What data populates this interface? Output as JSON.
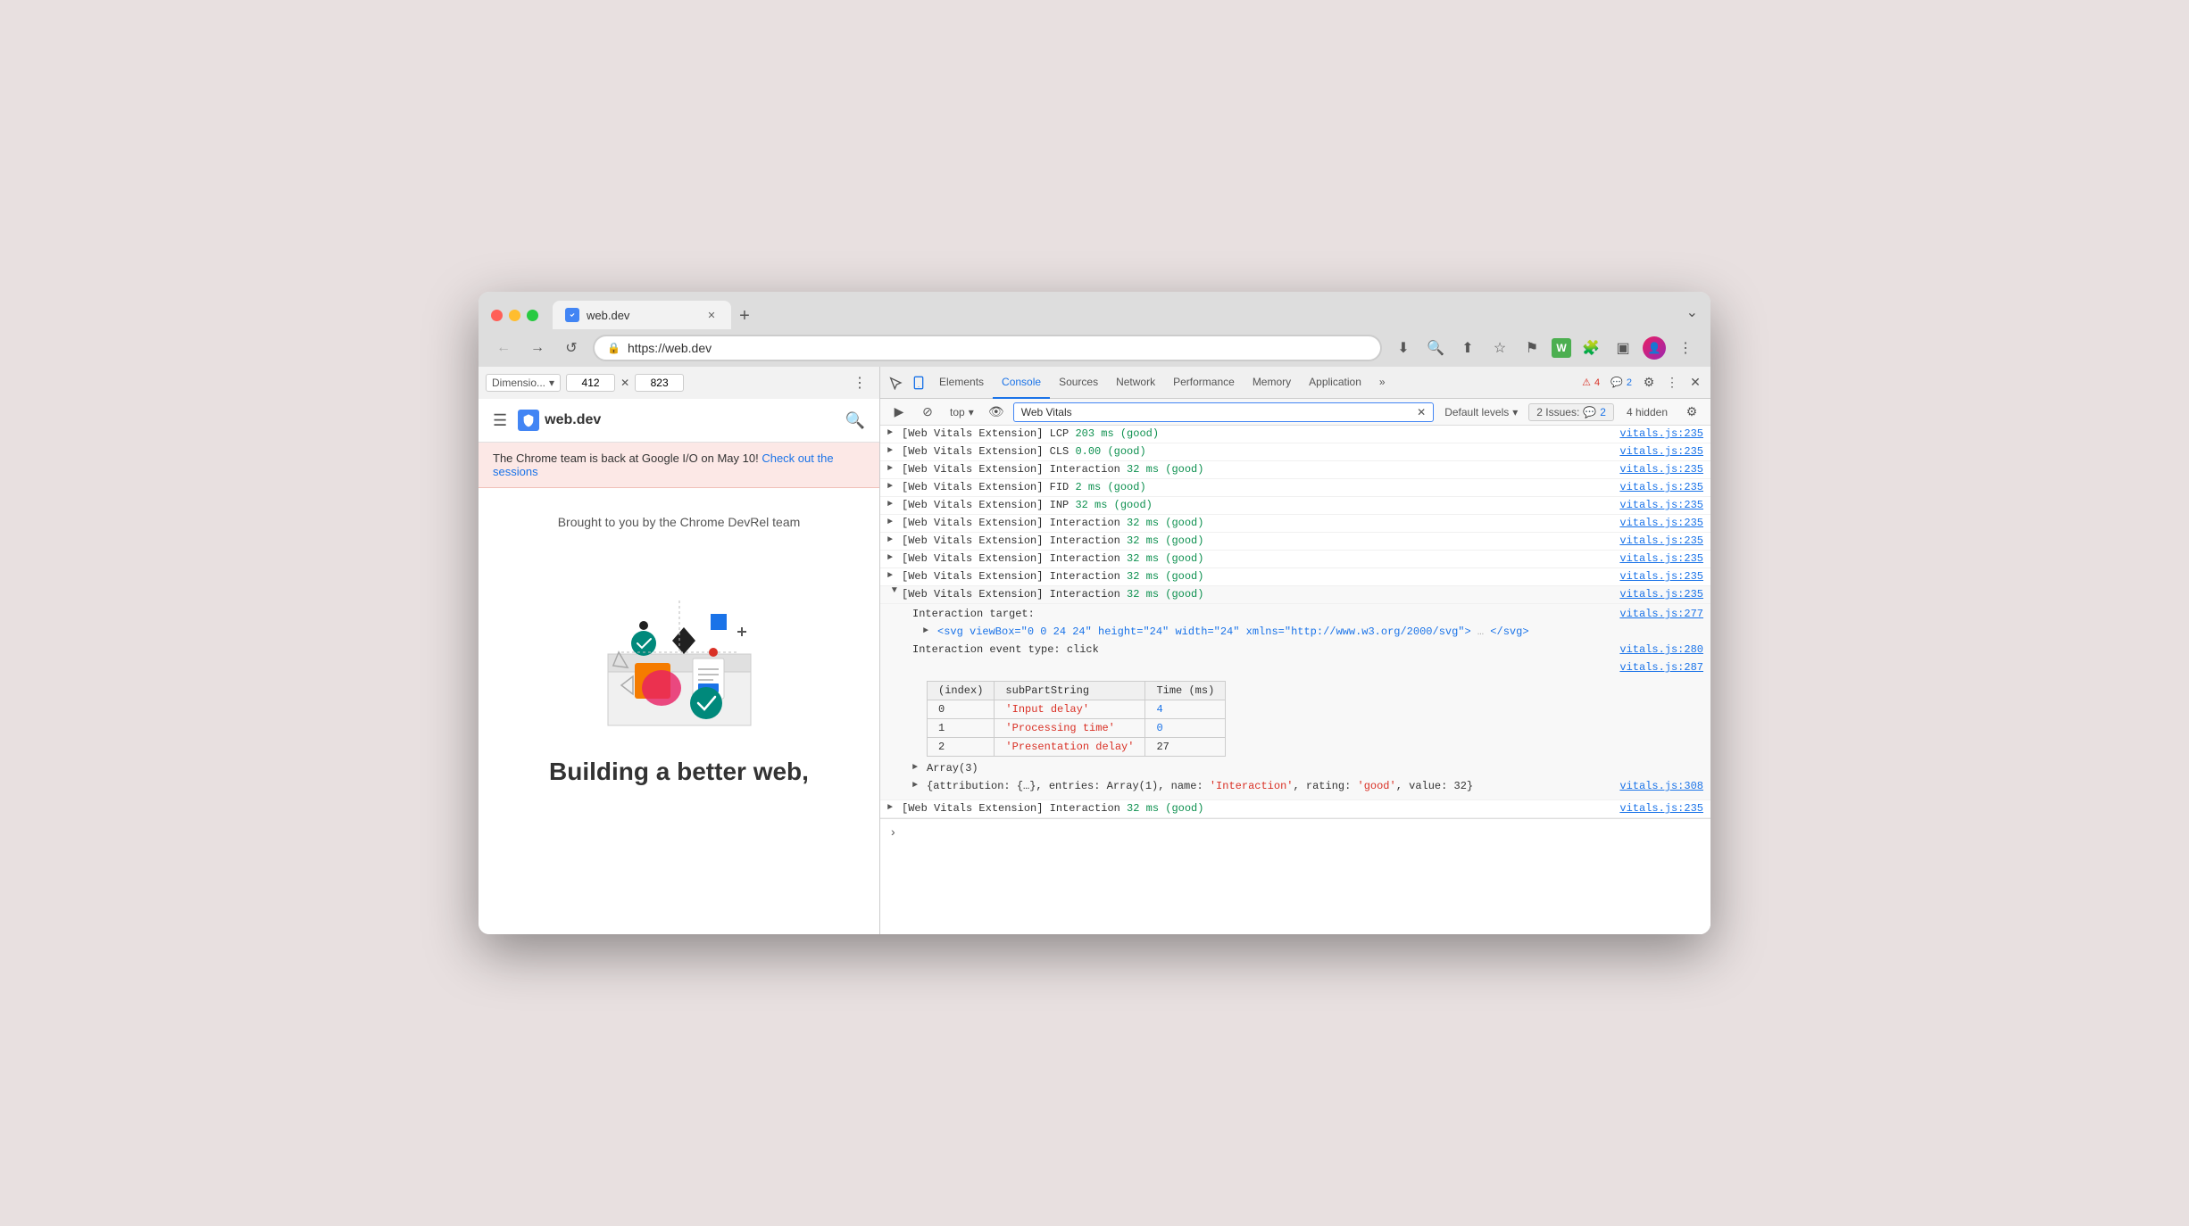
{
  "browser": {
    "tab_title": "web.dev",
    "tab_url": "https://web.dev",
    "new_tab_icon": "+",
    "chevron_down": "⌄"
  },
  "addressbar": {
    "url": "https://web.dev"
  },
  "devtools_tabs": [
    {
      "id": "elements",
      "label": "Elements",
      "active": false
    },
    {
      "id": "console",
      "label": "Console",
      "active": true
    },
    {
      "id": "sources",
      "label": "Sources",
      "active": false
    },
    {
      "id": "network",
      "label": "Network",
      "active": false
    },
    {
      "id": "performance",
      "label": "Performance",
      "active": false
    },
    {
      "id": "memory",
      "label": "Memory",
      "active": false
    },
    {
      "id": "application",
      "label": "Application",
      "active": false
    }
  ],
  "devtools_badges": {
    "warn_count": "4",
    "info_count": "2"
  },
  "console_filter": {
    "placeholder": "Web Vitals",
    "default_levels": "Default levels",
    "issues_label": "2 Issues:",
    "issues_count": "2",
    "hidden_label": "4 hidden"
  },
  "dim_bar": {
    "preset": "Dimensio...",
    "width": "412",
    "height": "823"
  },
  "page": {
    "site_name": "web.dev",
    "notification": "The Chrome team is back at Google I/O on May 10!",
    "notification_link": "Check out the sessions",
    "brought_by": "Brought to you by the Chrome DevRel team",
    "title": "Building a better web,"
  },
  "console_logs": [
    {
      "id": "log1",
      "expanded": false,
      "text": "[Web Vitals Extension] LCP ",
      "value": "203 ms",
      "value_color": "green",
      "suffix": " (good)",
      "suffix_color": "green",
      "source": "vitals.js:235"
    },
    {
      "id": "log2",
      "expanded": false,
      "text": "[Web Vitals Extension] CLS ",
      "value": "0.00",
      "value_color": "green",
      "suffix": " (good)",
      "suffix_color": "green",
      "source": "vitals.js:235"
    },
    {
      "id": "log3",
      "expanded": false,
      "text": "[Web Vitals Extension] Interaction ",
      "value": "32 ms",
      "value_color": "green",
      "suffix": " (good)",
      "suffix_color": "green",
      "source": "vitals.js:235"
    },
    {
      "id": "log4",
      "expanded": false,
      "text": "[Web Vitals Extension] FID ",
      "value": "2 ms",
      "value_color": "green",
      "suffix": " (good)",
      "suffix_color": "green",
      "source": "vitals.js:235"
    },
    {
      "id": "log5",
      "expanded": false,
      "text": "[Web Vitals Extension] INP ",
      "value": "32 ms",
      "value_color": "green",
      "suffix": " (good)",
      "suffix_color": "green",
      "source": "vitals.js:235"
    },
    {
      "id": "log6",
      "expanded": false,
      "text": "[Web Vitals Extension] Interaction ",
      "value": "32 ms",
      "value_color": "green",
      "suffix": " (good)",
      "suffix_color": "green",
      "source": "vitals.js:235"
    },
    {
      "id": "log7",
      "expanded": false,
      "text": "[Web Vitals Extension] Interaction ",
      "value": "32 ms",
      "value_color": "green",
      "suffix": " (good)",
      "suffix_color": "green",
      "source": "vitals.js:235"
    },
    {
      "id": "log8",
      "expanded": false,
      "text": "[Web Vitals Extension] Interaction ",
      "value": "32 ms",
      "value_color": "green",
      "suffix": " (good)",
      "suffix_color": "green",
      "source": "vitals.js:235"
    },
    {
      "id": "log9",
      "expanded": false,
      "text": "[Web Vitals Extension] Interaction ",
      "value": "32 ms",
      "value_color": "green",
      "suffix": " (good)",
      "suffix_color": "green",
      "source": "vitals.js:235"
    },
    {
      "id": "log10",
      "expanded": false,
      "text": "[Web Vitals Extension] Interaction ",
      "value": "32 ms",
      "value_color": "green",
      "suffix": " (good)",
      "suffix_color": "green",
      "source": "vitals.js:235"
    }
  ],
  "expanded_log": {
    "header_text": "[Web Vitals Extension] Interaction ",
    "header_value": "32 ms",
    "header_suffix": " (good)",
    "header_source": "vitals.js:235",
    "interaction_target_label": "Interaction target:",
    "svg_text": "► <svg viewBox=\"0 0 24 24\" height=\"24\" width=\"24\" xmlns=\"http://www.w3.org/2000/svg\"> … </svg>",
    "interaction_event_label": "Interaction event type: click",
    "interaction_event_source": "vitals.js:280",
    "blank_source": "vitals.js:287",
    "table_headers": [
      "(index)",
      "subPartString",
      "Time (ms)"
    ],
    "table_rows": [
      {
        "index": "0",
        "subPart": "'Input delay'",
        "time": "4"
      },
      {
        "index": "1",
        "subPart": "'Processing time'",
        "time": "0"
      },
      {
        "index": "2",
        "subPart": "'Presentation delay'",
        "time": "27"
      }
    ],
    "array_label": "► Array(3)",
    "attribution_text": "► {attribution: {…}, entries: Array(1), name: 'Interaction', rating: 'good', value: 32}",
    "attribution_source": "vitals.js:308"
  },
  "last_log": {
    "text": "[Web Vitals Extension] Interaction ",
    "value": "32 ms",
    "suffix": " (good)",
    "source": "vitals.js:235"
  }
}
